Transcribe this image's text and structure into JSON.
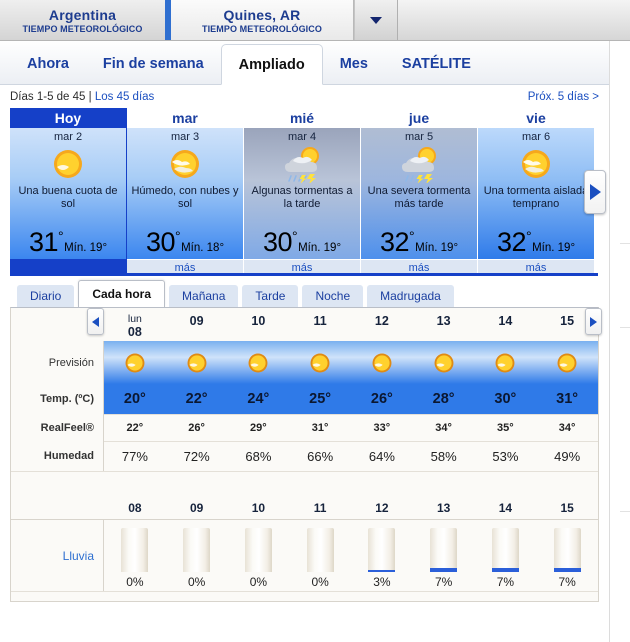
{
  "location_bar": {
    "tabs": [
      {
        "name": "Argentina",
        "subtitle": "TIEMPO METEOROLÓGICO",
        "active": false
      },
      {
        "name": "Quines, AR",
        "subtitle": "TIEMPO METEOROLÓGICO",
        "active": true
      }
    ],
    "dropdown_icon": "chevron-down-icon"
  },
  "nav": {
    "tabs": [
      {
        "label": "Ahora",
        "active": false
      },
      {
        "label": "Fin de semana",
        "active": false
      },
      {
        "label": "Ampliado",
        "active": true
      },
      {
        "label": "Mes",
        "active": false
      },
      {
        "label": "SATÉLITE",
        "active": false
      }
    ]
  },
  "range_bar": {
    "text": "Días 1-5 de 45",
    "separator": " | ",
    "all_days_link": "Los 45 días",
    "next_link": "Próx. 5 días >"
  },
  "days": [
    {
      "weekday": "Hoy",
      "date": "mar 2",
      "icon": "sun-icon",
      "description": "Una buena cuota de sol",
      "high": "31",
      "deg": "°",
      "low": "Mín. 19°",
      "more_label": "más",
      "selected": true,
      "theme": "grad-sunny"
    },
    {
      "weekday": "mar",
      "date": "mar 3",
      "icon": "sun-behind-cloud-icon",
      "description": "Húmedo, con nubes y sol",
      "high": "30",
      "deg": "°",
      "low": "Mín. 18°",
      "more_label": "más",
      "selected": false,
      "theme": "grad-sunny"
    },
    {
      "weekday": "mié",
      "date": "mar 4",
      "icon": "thunderstorm-icon",
      "description": "Algunas tormentas a la tarde",
      "high": "30",
      "deg": "°",
      "low": "Mín. 19°",
      "more_label": "más",
      "selected": false,
      "theme": "grad-storm"
    },
    {
      "weekday": "jue",
      "date": "mar 5",
      "icon": "thunderstorm-icon",
      "description": "Una severa tormenta más tarde",
      "high": "32",
      "deg": "°",
      "low": "Mín. 19°",
      "more_label": "más",
      "selected": false,
      "theme": "grad-storm2"
    },
    {
      "weekday": "vie",
      "date": "mar 6",
      "icon": "sun-behind-cloud-icon",
      "description": "Una tormenta aislada temprano",
      "high": "32",
      "deg": "°",
      "low": "Mín. 19°",
      "more_label": "más",
      "selected": false,
      "theme": "grad-clear"
    }
  ],
  "days_next_arrow": "arrow-right-icon",
  "subtabs": [
    {
      "label": "Diario",
      "active": false
    },
    {
      "label": "Cada hora",
      "active": true
    },
    {
      "label": "Mañana",
      "active": false
    },
    {
      "label": "Tarde",
      "active": false
    },
    {
      "label": "Noche",
      "active": false
    },
    {
      "label": "Madrugada",
      "active": false
    }
  ],
  "hourly": {
    "day_label": "lun",
    "prev_arrow": "arrow-left-icon",
    "next_arrow": "arrow-right-icon",
    "hours": [
      "08",
      "09",
      "10",
      "11",
      "12",
      "13",
      "14",
      "15"
    ],
    "row_labels": {
      "forecast": "Previsión",
      "temp": "Temp. (ºC)",
      "realfeel": "RealFeel®",
      "humidity": "Humedad",
      "rain": "Lluvia"
    },
    "forecast_icons": [
      "sun-icon",
      "sun-icon",
      "sun-icon",
      "sun-icon",
      "sun-icon",
      "sun-icon",
      "sun-icon",
      "sun-icon"
    ],
    "temp": [
      "20°",
      "22°",
      "24°",
      "25°",
      "26°",
      "28°",
      "30°",
      "31°"
    ],
    "realfeel": [
      "22°",
      "26°",
      "29°",
      "31°",
      "33°",
      "34°",
      "35°",
      "34°"
    ],
    "humidity": [
      "77%",
      "72%",
      "68%",
      "66%",
      "64%",
      "58%",
      "53%",
      "49%"
    ],
    "rain_pct": [
      "0%",
      "0%",
      "0%",
      "0%",
      "3%",
      "7%",
      "7%",
      "7%"
    ],
    "rain_values": [
      0,
      0,
      0,
      0,
      3,
      7,
      7,
      7
    ]
  },
  "colors": {
    "brand_blue": "#1b3fa0",
    "link_blue": "#1b4fc0",
    "selected_blue": "#1540c8",
    "temp_row_blue": "#2f7ae8",
    "rain_fill": "#2b5fd9"
  }
}
